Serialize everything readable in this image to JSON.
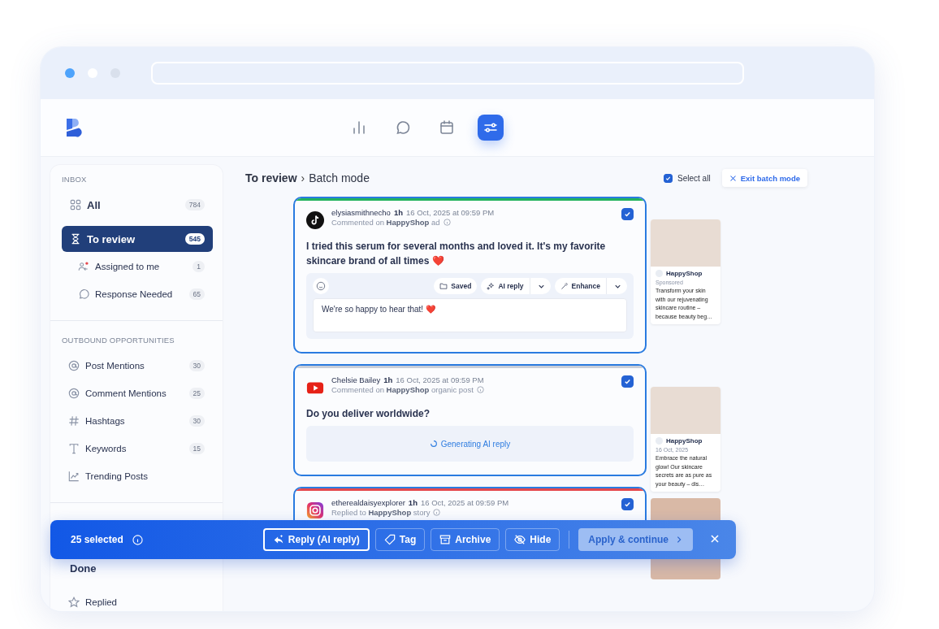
{
  "nav": [
    {
      "kind": "chart",
      "selected": false
    },
    {
      "kind": "chat",
      "selected": false
    },
    {
      "kind": "calendar",
      "selected": false
    },
    {
      "kind": "sliders",
      "selected": true
    }
  ],
  "sidebar": {
    "sections": [
      {
        "title": "INBOX",
        "items": [
          {
            "kind": "grid",
            "label": "All",
            "count": "784",
            "selected": false
          },
          {
            "kind": "hourglass",
            "label": "To review",
            "count": "545",
            "selected": true,
            "children": [
              {
                "kind": "people",
                "label": "Assigned to me",
                "count": "1",
                "selected": false
              },
              {
                "kind": "bubble",
                "label": "Response Needed",
                "count": "65",
                "selected": false
              }
            ]
          }
        ]
      },
      {
        "title": "OUTBOUND OPPORTUNITIES",
        "items": [
          {
            "kind": "at",
            "label": "Post Mentions",
            "count": "30",
            "selected": false
          },
          {
            "kind": "at",
            "label": "Comment Mentions",
            "count": "25",
            "selected": false
          },
          {
            "kind": "hash",
            "label": "Hashtags",
            "count": "30",
            "selected": false
          },
          {
            "kind": "type",
            "label": "Keywords",
            "count": "15",
            "selected": false
          },
          {
            "kind": "trend",
            "label": "Trending Posts",
            "selected": false
          }
        ]
      },
      {
        "items": [
          {
            "kind": "plain",
            "label": "Done",
            "selected": false
          },
          {
            "kind": "star",
            "label": "Replied",
            "selected": false
          }
        ]
      }
    ]
  },
  "breadcrumb": {
    "parent": "To review",
    "separator": "›",
    "current": "Batch mode"
  },
  "select_all": {
    "label": "Select all",
    "checked": true
  },
  "exit_button": "Exit batch mode",
  "cards": [
    {
      "kind": "tiktok",
      "color": "#22b35e",
      "username": "elysiasmithnecho",
      "age": "1h",
      "timestamp": "16 Oct, 2025 at 09:59 PM",
      "action": "Commented on **HappyShop** ad",
      "checked": true,
      "text": "I tried this serum for several months and loved it.  It's my favorite skincare brand of all times ❤️",
      "reply": {
        "kind": "draft",
        "value": "We're so happy to hear that! ❤️",
        "tools": [
          "Saved",
          "AI reply",
          "Enhance"
        ]
      },
      "preview": {
        "brand": "HappyShop",
        "meta": "Sponsored",
        "caption": "Transform your skin with our rejuvenating skincare routine – because beauty beg…"
      }
    },
    {
      "kind": "youtube",
      "color": "#c9ced8",
      "username": "Chelsie Bailey",
      "age": "1h",
      "timestamp": "16 Oct, 2025 at 09:59 PM",
      "action": "Commented on **HappyShop** organic post",
      "checked": true,
      "text": "Do you deliver worldwide?",
      "reply": {
        "kind": "generating",
        "status": "Generating AI reply"
      },
      "preview": {
        "brand": "HappyShop",
        "meta": "16 Oct, 2025",
        "caption": "Embrace the natural glow! Our skincare secrets are as pure as your beauty – dis…"
      }
    },
    {
      "kind": "instagram",
      "color": "#e5484d",
      "username": "etherealdaisyexplorer",
      "age": "1h",
      "timestamp": "16 Oct, 2025 at 09:59 PM",
      "action": "Replied to **HappyShop** story",
      "checked": true
    }
  ],
  "batch_bar": {
    "count": "25 selected",
    "actions": [
      {
        "kind": "reply",
        "label": "Reply (AI reply)",
        "selected": true
      },
      {
        "kind": "tag",
        "label": "Tag",
        "selected": false
      },
      {
        "kind": "archive",
        "label": "Archive",
        "selected": false
      },
      {
        "kind": "hide",
        "label": "Hide",
        "selected": false
      }
    ],
    "apply": {
      "label": "Apply & continue",
      "disabled": true
    }
  }
}
